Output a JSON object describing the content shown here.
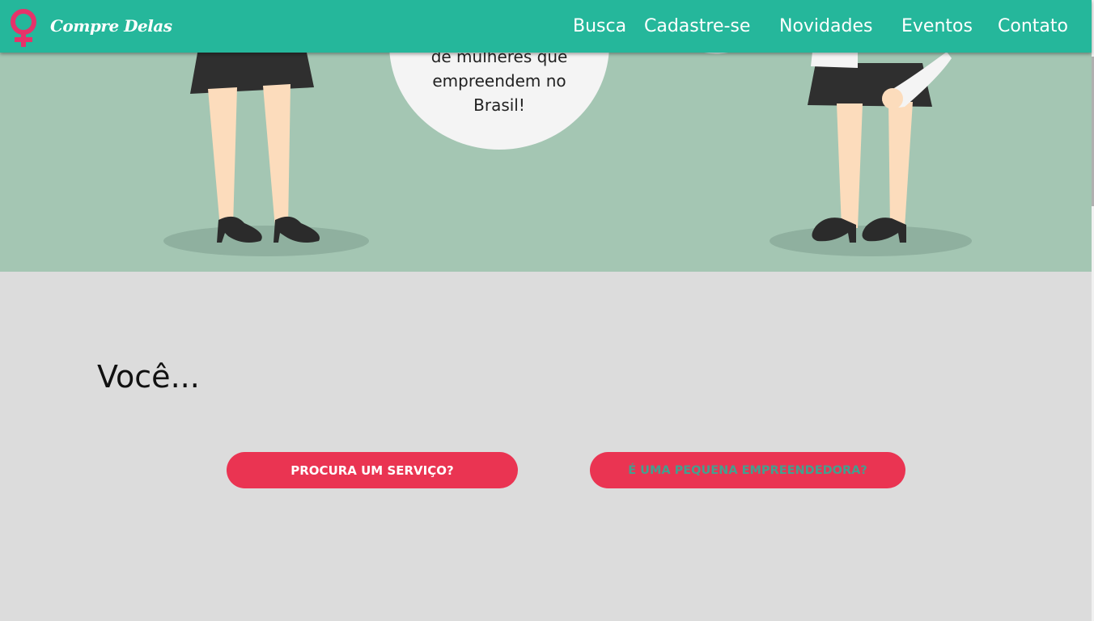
{
  "brand": {
    "name": "Compre Delas",
    "icon": "female-symbol-icon"
  },
  "nav": {
    "items": [
      {
        "label": "Busca"
      },
      {
        "label": "Cadastre-se"
      },
      {
        "label": "Novidades"
      },
      {
        "label": "Eventos"
      },
      {
        "label": "Contato"
      }
    ]
  },
  "hero": {
    "bubble_lines": [
      "de mulheres que",
      "empreendem no",
      "Brasil!"
    ]
  },
  "main": {
    "heading": "Você...",
    "buttons": [
      {
        "label": "PROCURA UM SERVIÇO?"
      },
      {
        "label": "É UMA PEQUENA EMPREENDEDORA?"
      }
    ]
  },
  "colors": {
    "navbar": "#25b79b",
    "brand_icon": "#e6336a",
    "hero_background": "#a4c6b3",
    "section_background": "#dcdcdc",
    "button": "#ea3452",
    "button2_text": "#43a08f"
  }
}
